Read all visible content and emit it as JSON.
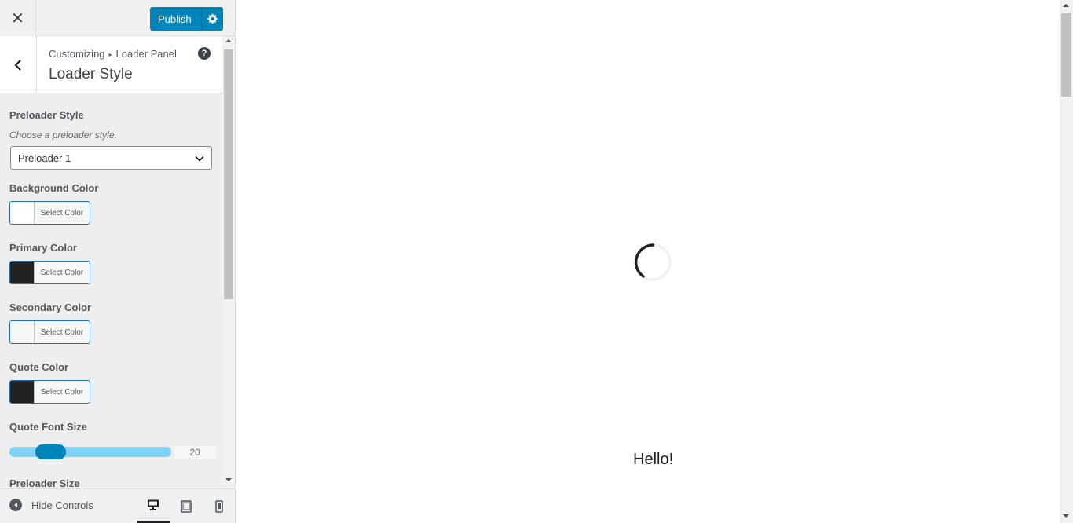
{
  "header": {
    "close_icon": "close-icon",
    "publish_label": "Publish",
    "settings_icon": "gear-icon"
  },
  "panel": {
    "back_icon": "chevron-left-icon",
    "breadcrumb": [
      "Customizing",
      "Loader Panel"
    ],
    "title": "Loader Style",
    "help_icon": "help-icon"
  },
  "controls": {
    "preloader_style": {
      "title": "Preloader Style",
      "description": "Choose a preloader style.",
      "selected": "Preloader 1"
    },
    "background_color": {
      "title": "Background Color",
      "button_label": "Select Color",
      "swatch": "#ffffff"
    },
    "primary_color": {
      "title": "Primary Color",
      "button_label": "Select Color",
      "swatch": "#222222"
    },
    "secondary_color": {
      "title": "Secondary Color",
      "button_label": "Select Color",
      "swatch": "#f6f7f7"
    },
    "quote_color": {
      "title": "Quote Color",
      "button_label": "Select Color",
      "swatch": "#222222"
    },
    "quote_font_size": {
      "title": "Quote Font Size",
      "value": "20"
    },
    "preloader_size": {
      "title": "Preloader Size"
    }
  },
  "footer": {
    "hide_controls_label": "Hide Controls",
    "devices": [
      "desktop",
      "tablet",
      "mobile"
    ],
    "active_device": "desktop"
  },
  "preview": {
    "greeting": "Hello!",
    "spinner_color": "#222222"
  },
  "colors": {
    "accent": "#0085ba",
    "slider_track": "#7fd3f7"
  }
}
